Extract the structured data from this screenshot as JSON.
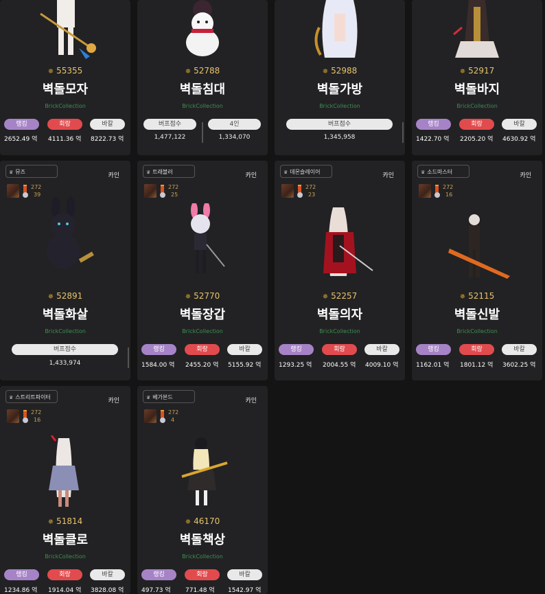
{
  "labels": {
    "cain": "카인",
    "brick": "BrickCollection",
    "ranking": "랭킹",
    "hoerang": "회랑",
    "bakal": "바칼",
    "buff_score": "버프점수",
    "four_person": "4인"
  },
  "cards": [
    {
      "score": "55355",
      "name": "벽돌모자",
      "rank": "2652.49 억",
      "dmg": "4111.36 억",
      "bakal": "8222.73 억"
    },
    {
      "score": "52788",
      "name": "벽돌침대",
      "buff": "1,477,122",
      "four": "1,334,070"
    },
    {
      "score": "52988",
      "name": "벽돌가방",
      "buff": "1,345,958"
    },
    {
      "score": "52917",
      "name": "벽돌바지",
      "rank": "1422.70 억",
      "dmg": "2205.20 억",
      "bakal": "4630.92 억"
    },
    {
      "job": "뮤즈",
      "lvl": "272",
      "cnt": "39",
      "score": "52891",
      "name": "벽돌화살",
      "buff": "1,433,974"
    },
    {
      "job": "트래블러",
      "lvl": "272",
      "cnt": "25",
      "score": "52770",
      "name": "벽돌장갑",
      "rank": "1584.00 억",
      "dmg": "2455.20 억",
      "bakal": "5155.92 억"
    },
    {
      "job": "데몬슬레이어",
      "lvl": "272",
      "cnt": "23",
      "score": "52257",
      "name": "벽돌의자",
      "rank": "1293.25 억",
      "dmg": "2004.55 억",
      "bakal": "4009.10 억"
    },
    {
      "job": "소드마스터",
      "lvl": "272",
      "cnt": "16",
      "score": "52115",
      "name": "벽돌신발",
      "rank": "1162.01 억",
      "dmg": "1801.12 억",
      "bakal": "3602.25 억"
    },
    {
      "job": "스트리트파이터",
      "lvl": "272",
      "cnt": "16",
      "score": "51814",
      "name": "벽돌클로",
      "rank": "1234.86 억",
      "dmg": "1914.04 억",
      "bakal": "3828.08 억"
    },
    {
      "job": "베가본드",
      "lvl": "272",
      "cnt": "4",
      "score": "46170",
      "name": "벽돌책상",
      "rank": "497.73 억",
      "dmg": "771.48 억",
      "bakal": "1542.97 억"
    }
  ]
}
